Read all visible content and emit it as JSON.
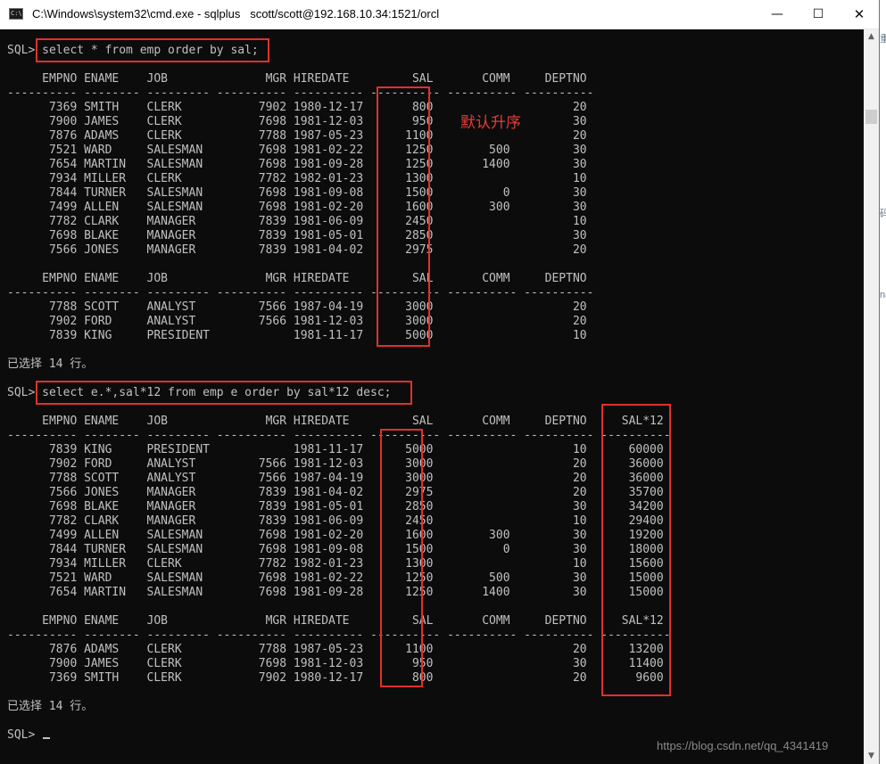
{
  "window": {
    "title": "C:\\Windows\\system32\\cmd.exe - sqlplus   scott/scott@192.168.10.34:1521/orcl",
    "minimize": "—",
    "maximize": "☐",
    "close": "✕"
  },
  "background_fragments": [
    "tr",
    "es",
    "最",
    "重",
    "码",
    "na"
  ],
  "console": {
    "lines": [
      "SQL> select * from emp order by sal;",
      "",
      "     EMPNO ENAME    JOB              MGR HIREDATE         SAL       COMM     DEPTNO",
      "---------- -------- --------- ---------- ---------- ---------- ---------- ----------",
      "      7369 SMITH    CLERK           7902 1980-12-17       800                    20",
      "      7900 JAMES    CLERK           7698 1981-12-03       950                    30",
      "      7876 ADAMS    CLERK           7788 1987-05-23      1100                    20",
      "      7521 WARD     SALESMAN        7698 1981-02-22      1250        500         30",
      "      7654 MARTIN   SALESMAN        7698 1981-09-28      1250       1400         30",
      "      7934 MILLER   CLERK           7782 1982-01-23      1300                    10",
      "      7844 TURNER   SALESMAN        7698 1981-09-08      1500          0         30",
      "      7499 ALLEN    SALESMAN        7698 1981-02-20      1600        300         30",
      "      7782 CLARK    MANAGER         7839 1981-06-09      2450                    10",
      "      7698 BLAKE    MANAGER         7839 1981-05-01      2850                    30",
      "      7566 JONES    MANAGER         7839 1981-04-02      2975                    20",
      "",
      "     EMPNO ENAME    JOB              MGR HIREDATE         SAL       COMM     DEPTNO",
      "---------- -------- --------- ---------- ---------- ---------- ---------- ----------",
      "      7788 SCOTT    ANALYST         7566 1987-04-19      3000                    20",
      "      7902 FORD     ANALYST         7566 1981-12-03      3000                    20",
      "      7839 KING     PRESIDENT            1981-11-17      5000                    10",
      "",
      "已选择 14 行。",
      "",
      "SQL> select e.*,sal*12 from emp e order by sal*12 desc;",
      "",
      "     EMPNO ENAME    JOB              MGR HIREDATE         SAL       COMM     DEPTNO     SAL*12",
      "---------- -------- --------- ---------- ---------- ---------- ---------- ---------- ----------",
      "      7839 KING     PRESIDENT            1981-11-17      5000                    10      60000",
      "      7902 FORD     ANALYST         7566 1981-12-03      3000                    20      36000",
      "      7788 SCOTT    ANALYST         7566 1987-04-19      3000                    20      36000",
      "      7566 JONES    MANAGER         7839 1981-04-02      2975                    20      35700",
      "      7698 BLAKE    MANAGER         7839 1981-05-01      2850                    30      34200",
      "      7782 CLARK    MANAGER         7839 1981-06-09      2450                    10      29400",
      "      7499 ALLEN    SALESMAN        7698 1981-02-20      1600        300         30      19200",
      "      7844 TURNER   SALESMAN        7698 1981-09-08      1500          0         30      18000",
      "      7934 MILLER   CLERK           7782 1982-01-23      1300                    10      15600",
      "      7521 WARD     SALESMAN        7698 1981-02-22      1250        500         30      15000",
      "      7654 MARTIN   SALESMAN        7698 1981-09-28      1250       1400         30      15000",
      "",
      "     EMPNO ENAME    JOB              MGR HIREDATE         SAL       COMM     DEPTNO     SAL*12",
      "---------- -------- --------- ---------- ---------- ---------- ---------- ---------- ----------",
      "      7876 ADAMS    CLERK           7788 1987-05-23      1100                    20      13200",
      "      7900 JAMES    CLERK           7698 1981-12-03       950                    30      11400",
      "      7369 SMITH    CLERK           7902 1980-12-17       800                    20       9600",
      "",
      "已选择 14 行。",
      "",
      "SQL> "
    ]
  },
  "annotation": "默认升序",
  "watermark": "https://blog.csdn.net/qq_4341419",
  "colors": {
    "console_bg": "#0c0c0c",
    "console_text": "#c0c0c0",
    "highlight_box": "#e0302d",
    "annotation": "#e43c37"
  }
}
